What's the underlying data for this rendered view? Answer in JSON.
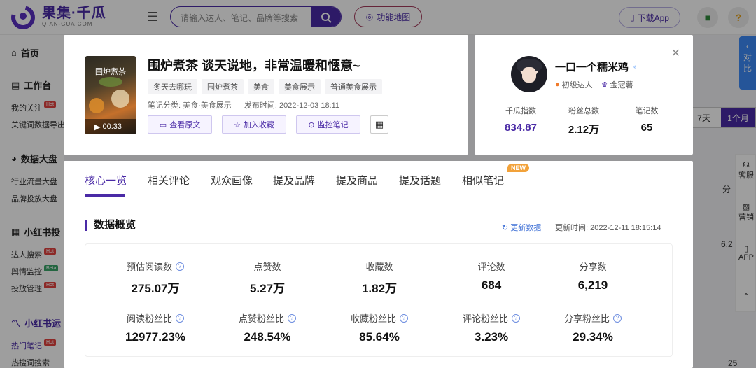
{
  "header": {
    "logo_zh": "果集·千瓜",
    "logo_en": "QIAN-GUA.COM",
    "search_placeholder": "请输入达人、笔记、品牌等搜索",
    "map_button": "功能地图",
    "download_button": "下载App"
  },
  "sidebar": {
    "home": "首页",
    "workspace": "工作台",
    "my_follow": "我的关注",
    "keyword_export": "关键词数据导出",
    "big_board": "数据大盘",
    "industry_board": "行业流量大盘",
    "brand_board": "品牌投放大盘",
    "redbook_invest": "小红书投",
    "talent_search": "达人搜索",
    "sentiment": "舆情监控",
    "invest_manage": "投放管理",
    "redbook_ops": "小红书运",
    "hot_notes": "热门笔记",
    "hot_words": "热搜词搜索",
    "tag_hot": "Hot",
    "tag_beta": "Beta"
  },
  "background": {
    "range_7d": "7天",
    "range_1m": "1个月",
    "col_share": "分",
    "val_62": "6,2",
    "val_25": "25",
    "float_service": "客服",
    "float_marketing": "营销",
    "float_app": "APP",
    "compare": "对比"
  },
  "note": {
    "title": "围炉煮茶 谈天说地，非常温暖和惬意~",
    "thumb_caption": "围炉煮茶",
    "duration": "00:33",
    "tags": [
      "冬天去哪玩",
      "围炉煮茶",
      "美食",
      "美食展示",
      "普通美食展示"
    ],
    "category": "笔记分类: 美食·美食展示",
    "publish_time": "发布时间:  2022-12-03 18:11",
    "actions": {
      "view_original": "查看原文",
      "add_favorite": "加入收藏",
      "monitor": "监控笔记"
    }
  },
  "author": {
    "name": "一口一个糯米鸡",
    "gender_symbol": "♂",
    "level": "初级达人",
    "badge": "金冠薯",
    "stats": [
      {
        "label": "千瓜指数",
        "value": "834.87"
      },
      {
        "label": "粉丝总数",
        "value": "2.12万"
      },
      {
        "label": "笔记数",
        "value": "65"
      }
    ]
  },
  "panel": {
    "tabs": [
      "核心一览",
      "相关评论",
      "观众画像",
      "提及品牌",
      "提及商品",
      "提及话题",
      "相似笔记"
    ],
    "new_badge": "NEW",
    "section_title": "数据概览",
    "refresh_label": "更新数据",
    "updated_at": "更新时间:   2022-12-11 18:15:14",
    "stats_row1": [
      {
        "label": "预估阅读数",
        "value": "275.07万",
        "help": true
      },
      {
        "label": "点赞数",
        "value": "5.27万",
        "help": false
      },
      {
        "label": "收藏数",
        "value": "1.82万",
        "help": false
      },
      {
        "label": "评论数",
        "value": "684",
        "help": false
      },
      {
        "label": "分享数",
        "value": "6,219",
        "help": false
      }
    ],
    "stats_row2": [
      {
        "label": "阅读粉丝比",
        "value": "12977.23%",
        "help": true
      },
      {
        "label": "点赞粉丝比",
        "value": "248.54%",
        "help": true
      },
      {
        "label": "收藏粉丝比",
        "value": "85.64%",
        "help": true
      },
      {
        "label": "评论粉丝比",
        "value": "3.23%",
        "help": true
      },
      {
        "label": "分享粉丝比",
        "value": "29.34%",
        "help": true
      }
    ]
  },
  "colors": {
    "brand_purple": "#4a2aa6",
    "badge_orange": "#f2a23a",
    "link_blue": "#3d6fd6"
  }
}
